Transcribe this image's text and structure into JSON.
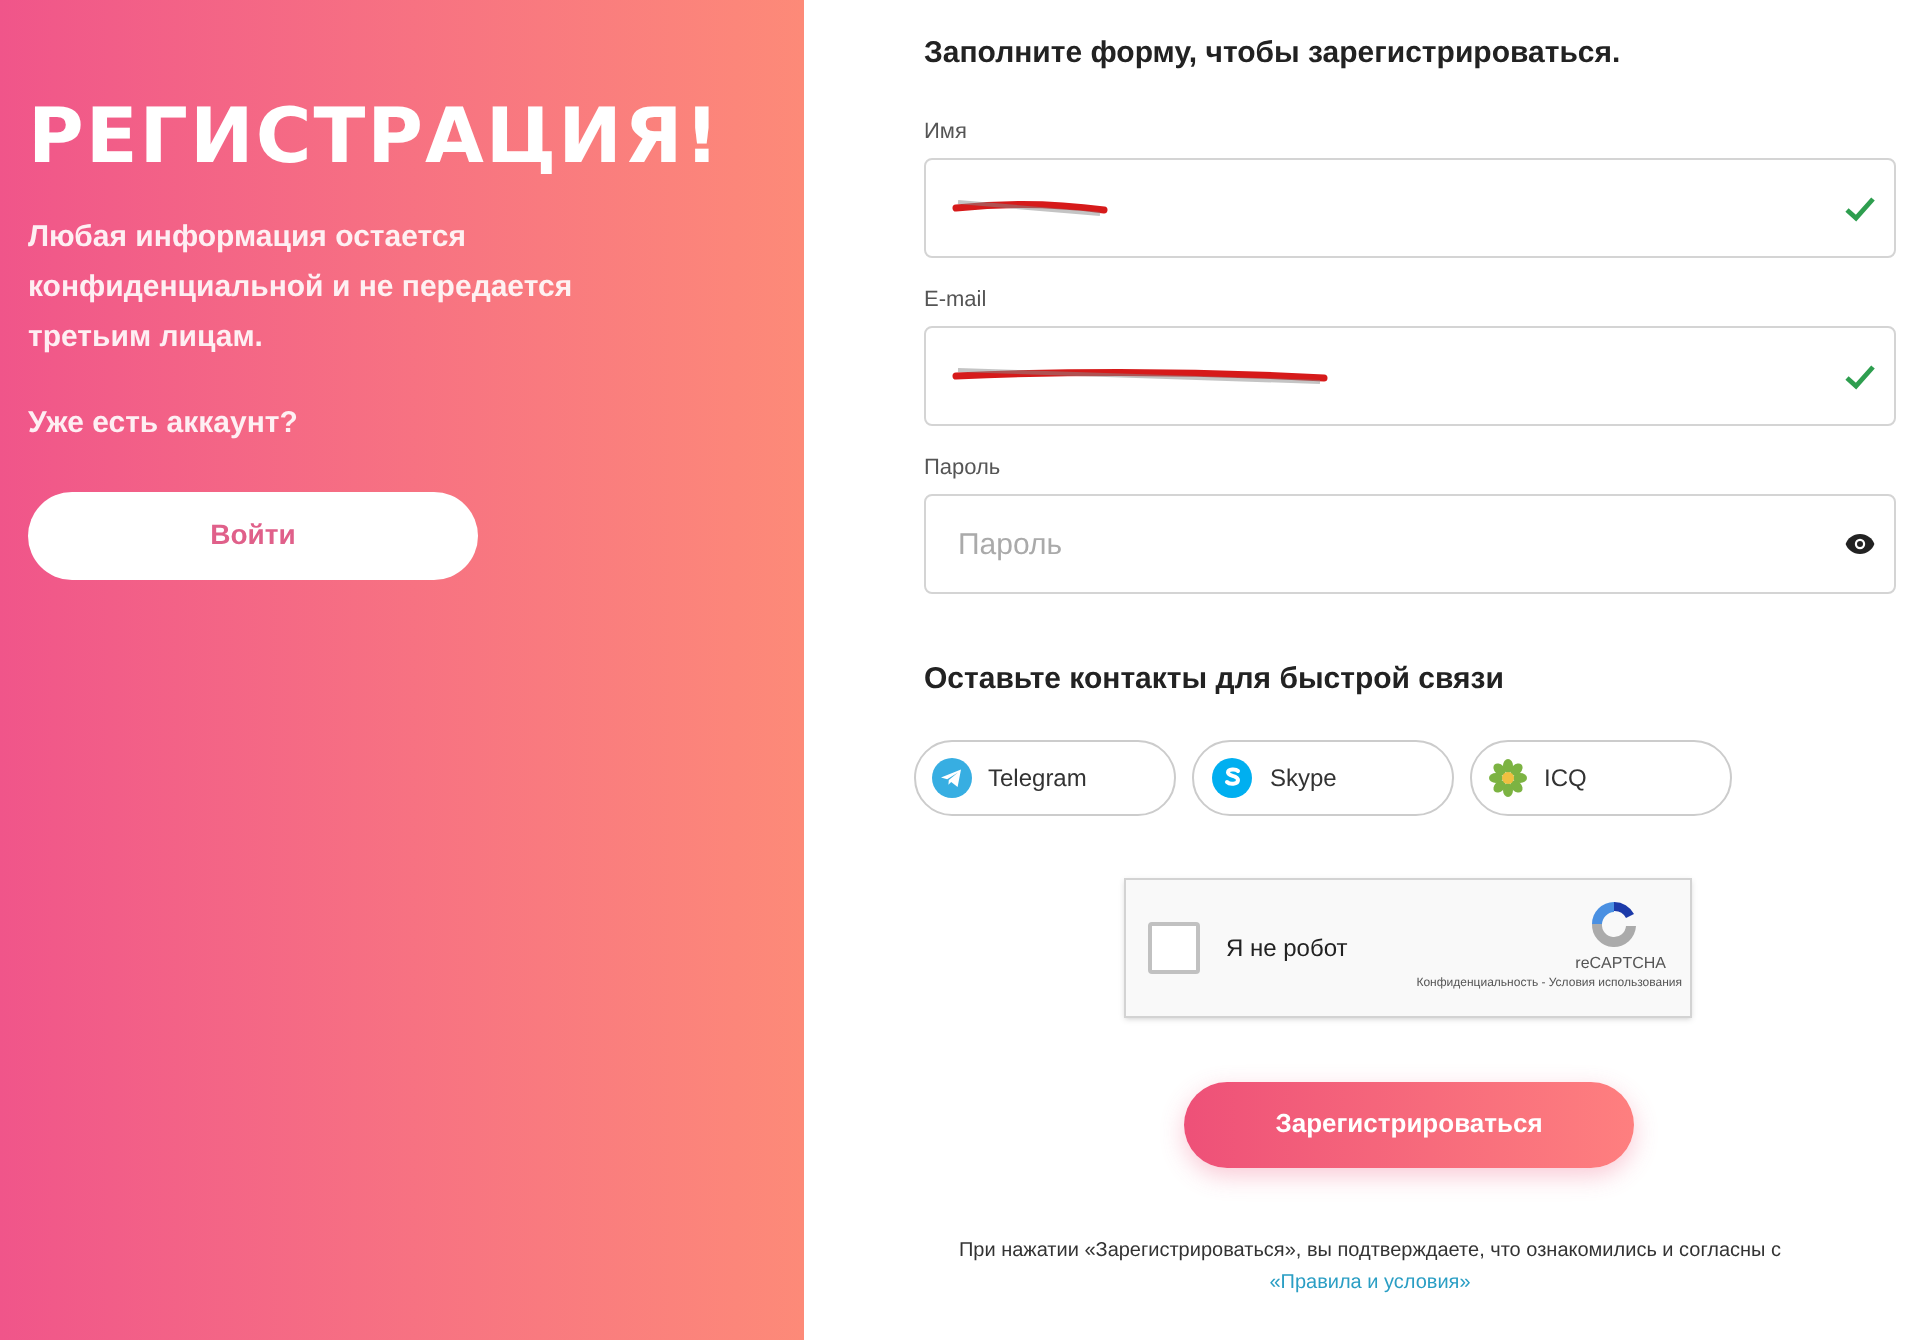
{
  "left": {
    "title": "РЕГИСТРАЦИЯ!",
    "description": "Любая информация остается конфиденциальной и не передается третьим лицам.",
    "question": "Уже есть аккаунт?",
    "login_button": "Войти"
  },
  "form": {
    "heading": "Заполните форму, чтобы зарегистрироваться.",
    "fields": [
      {
        "label": "Имя",
        "kind": "text",
        "valid": true
      },
      {
        "label": "E-mail",
        "kind": "text",
        "valid": true
      },
      {
        "label": "Пароль",
        "kind": "password",
        "placeholder": "Пароль"
      }
    ],
    "contacts_heading": "Оставьте контакты для быстрой связи",
    "contacts": [
      {
        "label": "Telegram",
        "kind": "telegram"
      },
      {
        "label": "Skype",
        "kind": "skype"
      },
      {
        "label": "ICQ",
        "kind": "icq"
      }
    ],
    "captcha": {
      "label": "Я не робот",
      "checked": false,
      "brand": "reCAPTCHA",
      "links": "Конфиденциальность - Условия использования"
    },
    "submit": "Зарегистрироваться",
    "terms": "При нажатии «Зарегистрироваться», вы подтверждаете, что ознакомились и согласны с",
    "terms_link": "«Правила и условия»"
  }
}
